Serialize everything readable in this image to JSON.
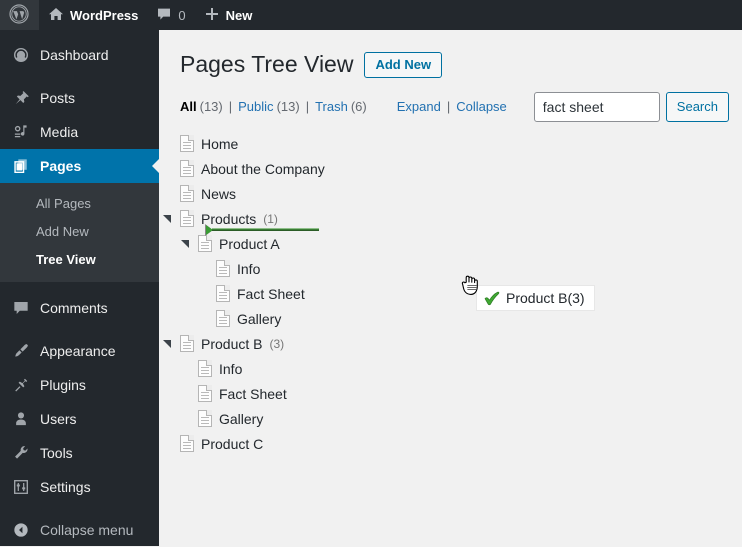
{
  "adminbar": {
    "logo_icon": "wordpress-logo-icon",
    "site_icon": "home-icon",
    "site_name": "WordPress",
    "comments_icon": "comment-bubble-icon",
    "comments_count": "0",
    "new_icon": "plus-icon",
    "new_label": "New"
  },
  "sidebar": {
    "items": [
      {
        "label": "Dashboard",
        "icon": "dashboard-icon",
        "current": false
      },
      {
        "label": "Posts",
        "icon": "pin-icon",
        "current": false
      },
      {
        "label": "Media",
        "icon": "media-icon",
        "current": false
      },
      {
        "label": "Pages",
        "icon": "pages-icon",
        "current": true
      },
      {
        "label": "Comments",
        "icon": "comment-bubble-icon",
        "current": false
      },
      {
        "label": "Appearance",
        "icon": "paintbrush-icon",
        "current": false
      },
      {
        "label": "Plugins",
        "icon": "plug-icon",
        "current": false
      },
      {
        "label": "Users",
        "icon": "user-icon",
        "current": false
      },
      {
        "label": "Tools",
        "icon": "wrench-icon",
        "current": false
      },
      {
        "label": "Settings",
        "icon": "sliders-icon",
        "current": false
      }
    ],
    "submenu": [
      {
        "label": "All Pages",
        "current": false
      },
      {
        "label": "Add New",
        "current": false
      },
      {
        "label": "Tree View",
        "current": true
      }
    ],
    "collapse": {
      "label": "Collapse menu",
      "icon": "collapse-arrow-icon"
    }
  },
  "header": {
    "title": "Pages Tree View",
    "add_new_label": "Add New"
  },
  "filters": {
    "items": [
      {
        "label": "All",
        "count": "(13)",
        "current": true
      },
      {
        "label": "Public",
        "count": "(13)",
        "current": false
      },
      {
        "label": "Trash",
        "count": "(6)",
        "current": false
      }
    ],
    "separator": "|",
    "expand_label": "Expand",
    "collapse_label": "Collapse"
  },
  "search": {
    "value": "fact sheet",
    "placeholder": "",
    "button_label": "Search"
  },
  "tree": {
    "nodes": [
      {
        "label": "Home",
        "count": "",
        "depth": 0,
        "twisty": false
      },
      {
        "label": "About the Company",
        "count": "",
        "depth": 0,
        "twisty": false
      },
      {
        "label": "News",
        "count": "",
        "depth": 0,
        "twisty": false
      },
      {
        "label": "Products",
        "count": "(1)",
        "depth": 0,
        "twisty": true
      },
      {
        "label": "Product A",
        "count": "",
        "depth": 1,
        "twisty": true
      },
      {
        "label": "Info",
        "count": "",
        "depth": 2,
        "twisty": false
      },
      {
        "label": "Fact Sheet",
        "count": "",
        "depth": 2,
        "twisty": false
      },
      {
        "label": "Gallery",
        "count": "",
        "depth": 2,
        "twisty": false
      },
      {
        "label": "Product B",
        "count": "(3)",
        "depth": 0,
        "twisty": true
      },
      {
        "label": "Info",
        "count": "",
        "depth": 1,
        "twisty": false
      },
      {
        "label": "Fact Sheet",
        "count": "",
        "depth": 1,
        "twisty": false
      },
      {
        "label": "Gallery",
        "count": "",
        "depth": 1,
        "twisty": false
      },
      {
        "label": "Product C",
        "count": "",
        "depth": 0,
        "twisty": false
      }
    ]
  },
  "drag": {
    "ghost_label": "Product B(3)",
    "ghost_icon": "green-check-icon",
    "cursor_icon": "grabbing-hand-cursor-icon",
    "drop_indicator_icon": "drop-position-arrow-icon"
  },
  "colors": {
    "admin_dark": "#23282d",
    "admin_submenu": "#32373c",
    "accent_blue": "#0073aa",
    "link_blue": "#2271b1",
    "content_bg": "#f1f1f1",
    "drop_green": "#3a7d35",
    "check_green": "#3fa832"
  }
}
